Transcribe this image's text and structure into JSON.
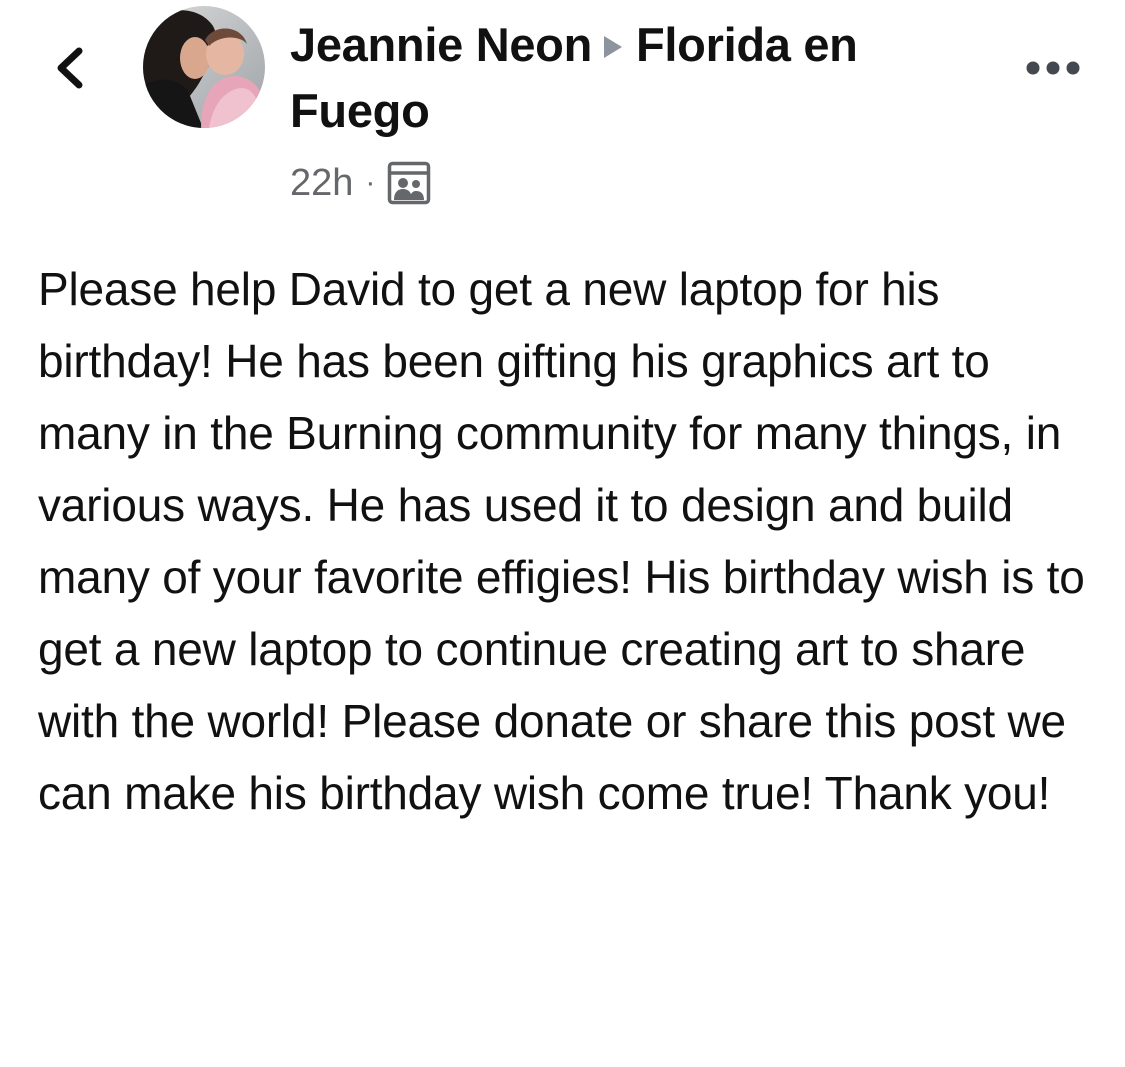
{
  "post": {
    "author": "Jeannie Neon",
    "group": "Florida en Fuego",
    "timestamp": "22h",
    "separator": "·",
    "audience_icon": "group-members-icon",
    "text": "Please help David to get a new laptop for his birthday! He has been gifting his graphics art to many in the Burning community for many things, in various ways. He has used it to design and build many of your favorite effigies! His birthday wish is to get a new laptop to continue creating art to share with the world! Please donate or share this post we can make his birthday wish come true! Thank you!"
  },
  "icons": {
    "back": "chevron-left-icon",
    "more": "more-options-icon",
    "avatar": "profile-avatar"
  },
  "colors": {
    "text": "#111111",
    "secondary_text": "#65676b",
    "arrow": "#8d949e",
    "background": "#ffffff"
  }
}
